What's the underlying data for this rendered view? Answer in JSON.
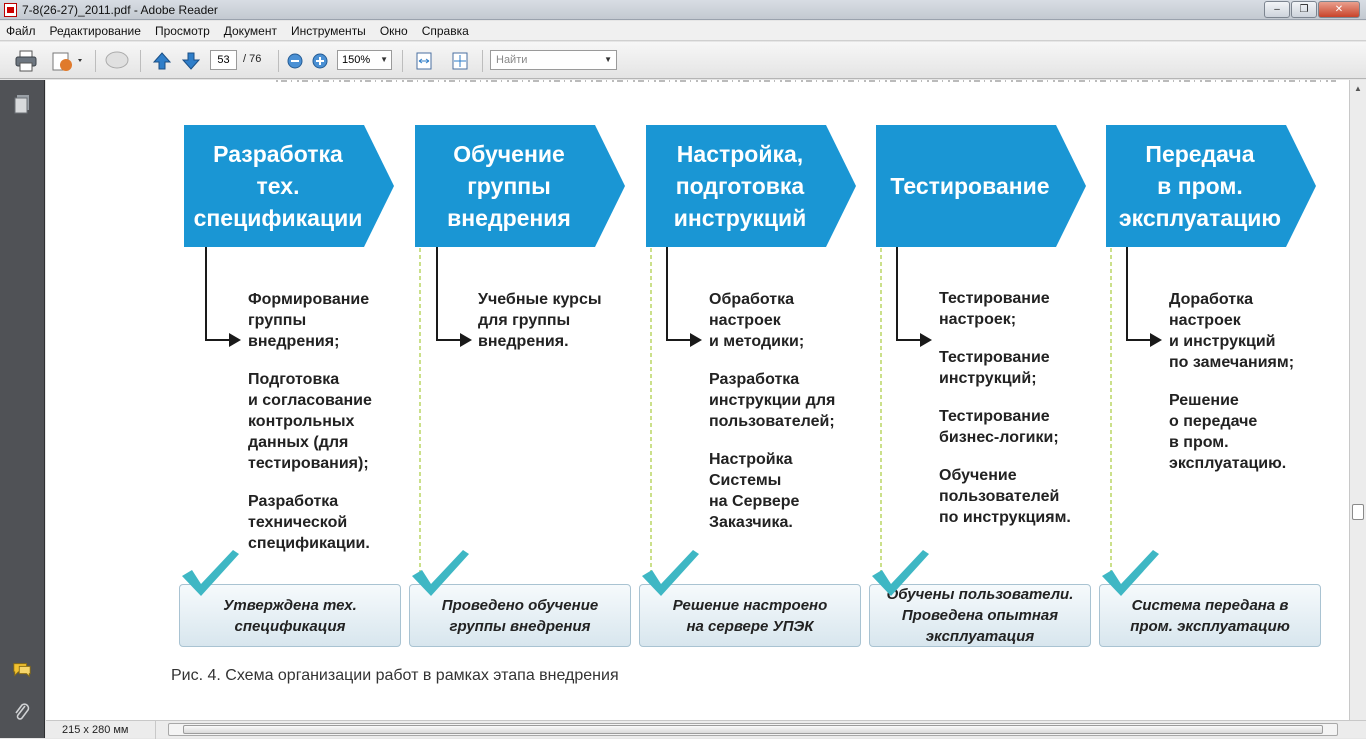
{
  "window": {
    "title": "7-8(26-27)_2011.pdf - Adobe Reader",
    "controls": [
      "–",
      "❐",
      "✕"
    ]
  },
  "menu": [
    "Файл",
    "Редактирование",
    "Просмотр",
    "Документ",
    "Инструменты",
    "Окно",
    "Справка"
  ],
  "toolbar": {
    "page_current": "53",
    "page_total": "/ 76",
    "zoom": "150%",
    "search_placeholder": "Найти"
  },
  "status": {
    "page_size": "215 x 280 мм"
  },
  "diagram": {
    "accent_color": "#1a96d4",
    "check_color": "#3eb7c4",
    "stages": [
      {
        "title": "Разработка\nтех.\nспецификации",
        "tasks": [
          "Формирование\nгруппы\nвнедрения;",
          "Подготовка\nи согласование\nконтрольных\nданных (для\nтестирования);",
          "Разработка\nтехнической\nспецификации."
        ],
        "result": "Утверждена тех.\nспецификация"
      },
      {
        "title": "Обучение\nгруппы\nвнедрения",
        "tasks": [
          "Учебные курсы\nдля группы\nвнедрения."
        ],
        "result": "Проведено обучение\nгруппы внедрения"
      },
      {
        "title": "Настройка,\nподготовка\nинструкций",
        "tasks": [
          "Обработка\nнастроек\nи методики;",
          "Разработка\nинструкции для\nпользователей;",
          "Настройка\nСистемы\nна Сервере\nЗаказчика."
        ],
        "result": "Решение настроено\nна сервере УПЭК"
      },
      {
        "title": "Тестирование",
        "tasks": [
          "Тестирование\nнастроек;",
          "Тестирование\nинструкций;",
          "Тестирование\nбизнес-логики;",
          "Обучение\nпользователей\nпо инструкциям."
        ],
        "result": "Обучены пользователи.\nПроведена опытная\nэксплуатация"
      },
      {
        "title": "Передача\nв пром.\nэксплуатацию",
        "tasks": [
          "Доработка\nнастроек\nи инструкций\nпо замечаниям;",
          "Решение\nо передаче\nв пром.\nэксплуатацию."
        ],
        "result": "Система передана в\nпром. эксплуатацию"
      }
    ],
    "caption": "Рис. 4. Схема организации работ в рамках этапа внедрения"
  }
}
